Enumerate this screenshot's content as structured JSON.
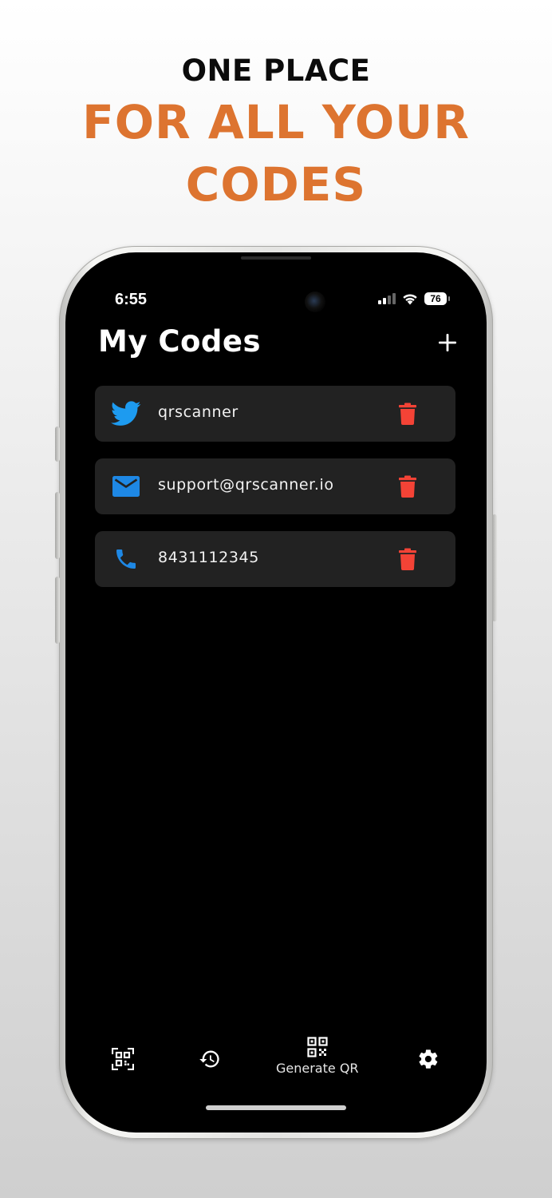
{
  "headline": {
    "line1": "ONE PLACE",
    "line2a": "FOR ALL YOUR",
    "line2b": "CODES"
  },
  "status_bar": {
    "time": "6:55",
    "battery": "76"
  },
  "header": {
    "title": "My Codes",
    "add_icon": "plus-icon"
  },
  "codes": [
    {
      "type": "twitter",
      "icon": "twitter-icon",
      "icon_color": "#1d9bf0",
      "value": "qrscanner"
    },
    {
      "type": "email",
      "icon": "mail-icon",
      "icon_color": "#1e88e5",
      "value": "support@qrscanner.io"
    },
    {
      "type": "phone",
      "icon": "phone-icon",
      "icon_color": "#1e88e5",
      "value": "8431112345"
    }
  ],
  "delete_icon_color": "#f44336",
  "accent_color": "#dd7430",
  "bottom_nav": {
    "items": [
      {
        "icon": "qr-scan-icon",
        "label": ""
      },
      {
        "icon": "history-icon",
        "label": ""
      },
      {
        "icon": "qr-code-icon",
        "label": "Generate QR"
      },
      {
        "icon": "settings-gear-icon",
        "label": ""
      }
    ]
  }
}
